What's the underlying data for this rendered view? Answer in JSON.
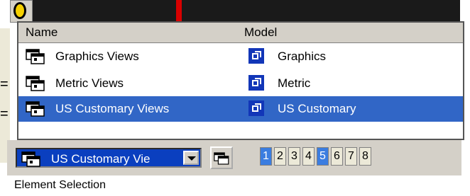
{
  "dropdown": {
    "header": {
      "name": "Name",
      "model": "Model"
    },
    "items": [
      {
        "name": "Graphics Views",
        "model": "Graphics",
        "selected": false
      },
      {
        "name": "Metric Views",
        "model": "Metric",
        "selected": false
      },
      {
        "name": "US Customary Views",
        "model": "US Customary",
        "selected": true
      }
    ]
  },
  "toolbar": {
    "combo_value": "US Customary Vie",
    "number_buttons": [
      {
        "label": "1",
        "active": true
      },
      {
        "label": "2",
        "active": false
      },
      {
        "label": "3",
        "active": false
      },
      {
        "label": "4",
        "active": false
      },
      {
        "label": "5",
        "active": true
      },
      {
        "label": "6",
        "active": false
      },
      {
        "label": "7",
        "active": false
      },
      {
        "label": "8",
        "active": false
      }
    ]
  },
  "footer": {
    "section_label": "Element Selection"
  },
  "colors": {
    "selection": "#3166c6",
    "model_icon": "#1236b8",
    "toolbar_bg": "#d4d0c8"
  },
  "icons": {
    "view_set": "views-icon",
    "model": "model-icon",
    "dropdown_arrow": "chevron-down-icon"
  }
}
